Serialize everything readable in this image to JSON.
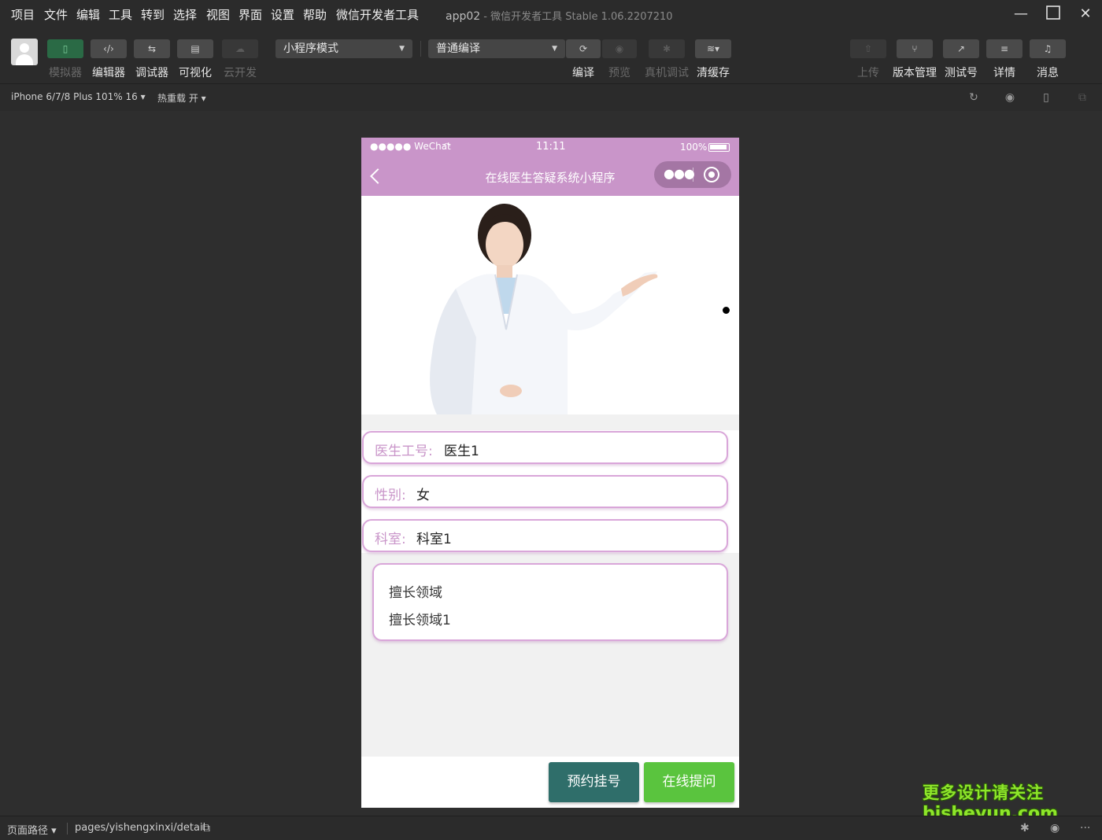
{
  "menu": {
    "items": [
      "项目",
      "文件",
      "编辑",
      "工具",
      "转到",
      "选择",
      "视图",
      "界面",
      "设置",
      "帮助",
      "微信开发者工具"
    ],
    "project_name": "app02",
    "app_title": " - 微信开发者工具 Stable 1.06.2207210"
  },
  "toolbar": {
    "simulator": "模拟器",
    "editor": "编辑器",
    "debugger": "调试器",
    "visual": "可视化",
    "cloud": "云开发",
    "mode_select": "小程序模式",
    "compile_select": "普通编译",
    "compile": "编译",
    "preview": "预览",
    "remote_debug": "真机调试",
    "clear_cache": "清缓存",
    "upload": "上传",
    "version": "版本管理",
    "test_account": "测试号",
    "details": "详情",
    "messages": "消息"
  },
  "subbar": {
    "device": "iPhone 6/7/8 Plus 101% 16",
    "hot_reload": "热重载 开"
  },
  "phone": {
    "status_signal": "●●●●● WeChat",
    "status_time": "11:11",
    "status_battery": "100%",
    "nav_title": "在线医生答疑系统小程序",
    "fields": [
      {
        "label": "医生工号:",
        "value": "医生1"
      },
      {
        "label": "性别:",
        "value": "女"
      },
      {
        "label": "科室:",
        "value": "科室1"
      }
    ],
    "specialty_title": "擅长领域",
    "specialty_value": "擅长领域1",
    "btn_appointment": "预约挂号",
    "btn_ask": "在线提问"
  },
  "statusline": {
    "path_label": "页面路径",
    "path_value": "pages/yishengxinxi/detail"
  },
  "watermark": {
    "line1": "更多设计请关注",
    "line2": "bisheyun.com"
  },
  "colors": {
    "accent": "#c995c9",
    "teal_button": "#2f6e6a",
    "green_button": "#5ac43e"
  }
}
